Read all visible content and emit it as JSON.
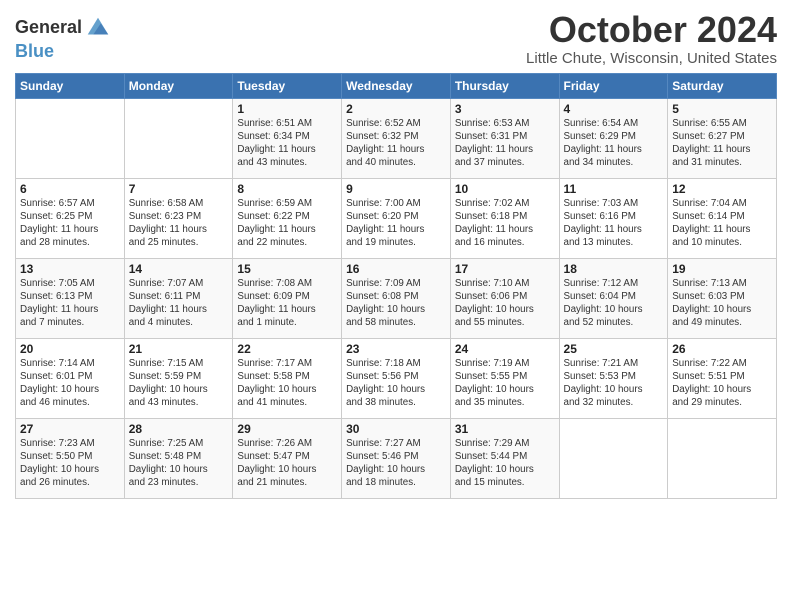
{
  "logo": {
    "line1": "General",
    "line2": "Blue"
  },
  "title": "October 2024",
  "subtitle": "Little Chute, Wisconsin, United States",
  "header": {
    "days": [
      "Sunday",
      "Monday",
      "Tuesday",
      "Wednesday",
      "Thursday",
      "Friday",
      "Saturday"
    ]
  },
  "weeks": [
    [
      {
        "day": "",
        "info": ""
      },
      {
        "day": "",
        "info": ""
      },
      {
        "day": "1",
        "info": "Sunrise: 6:51 AM\nSunset: 6:34 PM\nDaylight: 11 hours\nand 43 minutes."
      },
      {
        "day": "2",
        "info": "Sunrise: 6:52 AM\nSunset: 6:32 PM\nDaylight: 11 hours\nand 40 minutes."
      },
      {
        "day": "3",
        "info": "Sunrise: 6:53 AM\nSunset: 6:31 PM\nDaylight: 11 hours\nand 37 minutes."
      },
      {
        "day": "4",
        "info": "Sunrise: 6:54 AM\nSunset: 6:29 PM\nDaylight: 11 hours\nand 34 minutes."
      },
      {
        "day": "5",
        "info": "Sunrise: 6:55 AM\nSunset: 6:27 PM\nDaylight: 11 hours\nand 31 minutes."
      }
    ],
    [
      {
        "day": "6",
        "info": "Sunrise: 6:57 AM\nSunset: 6:25 PM\nDaylight: 11 hours\nand 28 minutes."
      },
      {
        "day": "7",
        "info": "Sunrise: 6:58 AM\nSunset: 6:23 PM\nDaylight: 11 hours\nand 25 minutes."
      },
      {
        "day": "8",
        "info": "Sunrise: 6:59 AM\nSunset: 6:22 PM\nDaylight: 11 hours\nand 22 minutes."
      },
      {
        "day": "9",
        "info": "Sunrise: 7:00 AM\nSunset: 6:20 PM\nDaylight: 11 hours\nand 19 minutes."
      },
      {
        "day": "10",
        "info": "Sunrise: 7:02 AM\nSunset: 6:18 PM\nDaylight: 11 hours\nand 16 minutes."
      },
      {
        "day": "11",
        "info": "Sunrise: 7:03 AM\nSunset: 6:16 PM\nDaylight: 11 hours\nand 13 minutes."
      },
      {
        "day": "12",
        "info": "Sunrise: 7:04 AM\nSunset: 6:14 PM\nDaylight: 11 hours\nand 10 minutes."
      }
    ],
    [
      {
        "day": "13",
        "info": "Sunrise: 7:05 AM\nSunset: 6:13 PM\nDaylight: 11 hours\nand 7 minutes."
      },
      {
        "day": "14",
        "info": "Sunrise: 7:07 AM\nSunset: 6:11 PM\nDaylight: 11 hours\nand 4 minutes."
      },
      {
        "day": "15",
        "info": "Sunrise: 7:08 AM\nSunset: 6:09 PM\nDaylight: 11 hours\nand 1 minute."
      },
      {
        "day": "16",
        "info": "Sunrise: 7:09 AM\nSunset: 6:08 PM\nDaylight: 10 hours\nand 58 minutes."
      },
      {
        "day": "17",
        "info": "Sunrise: 7:10 AM\nSunset: 6:06 PM\nDaylight: 10 hours\nand 55 minutes."
      },
      {
        "day": "18",
        "info": "Sunrise: 7:12 AM\nSunset: 6:04 PM\nDaylight: 10 hours\nand 52 minutes."
      },
      {
        "day": "19",
        "info": "Sunrise: 7:13 AM\nSunset: 6:03 PM\nDaylight: 10 hours\nand 49 minutes."
      }
    ],
    [
      {
        "day": "20",
        "info": "Sunrise: 7:14 AM\nSunset: 6:01 PM\nDaylight: 10 hours\nand 46 minutes."
      },
      {
        "day": "21",
        "info": "Sunrise: 7:15 AM\nSunset: 5:59 PM\nDaylight: 10 hours\nand 43 minutes."
      },
      {
        "day": "22",
        "info": "Sunrise: 7:17 AM\nSunset: 5:58 PM\nDaylight: 10 hours\nand 41 minutes."
      },
      {
        "day": "23",
        "info": "Sunrise: 7:18 AM\nSunset: 5:56 PM\nDaylight: 10 hours\nand 38 minutes."
      },
      {
        "day": "24",
        "info": "Sunrise: 7:19 AM\nSunset: 5:55 PM\nDaylight: 10 hours\nand 35 minutes."
      },
      {
        "day": "25",
        "info": "Sunrise: 7:21 AM\nSunset: 5:53 PM\nDaylight: 10 hours\nand 32 minutes."
      },
      {
        "day": "26",
        "info": "Sunrise: 7:22 AM\nSunset: 5:51 PM\nDaylight: 10 hours\nand 29 minutes."
      }
    ],
    [
      {
        "day": "27",
        "info": "Sunrise: 7:23 AM\nSunset: 5:50 PM\nDaylight: 10 hours\nand 26 minutes."
      },
      {
        "day": "28",
        "info": "Sunrise: 7:25 AM\nSunset: 5:48 PM\nDaylight: 10 hours\nand 23 minutes."
      },
      {
        "day": "29",
        "info": "Sunrise: 7:26 AM\nSunset: 5:47 PM\nDaylight: 10 hours\nand 21 minutes."
      },
      {
        "day": "30",
        "info": "Sunrise: 7:27 AM\nSunset: 5:46 PM\nDaylight: 10 hours\nand 18 minutes."
      },
      {
        "day": "31",
        "info": "Sunrise: 7:29 AM\nSunset: 5:44 PM\nDaylight: 10 hours\nand 15 minutes."
      },
      {
        "day": "",
        "info": ""
      },
      {
        "day": "",
        "info": ""
      }
    ]
  ]
}
